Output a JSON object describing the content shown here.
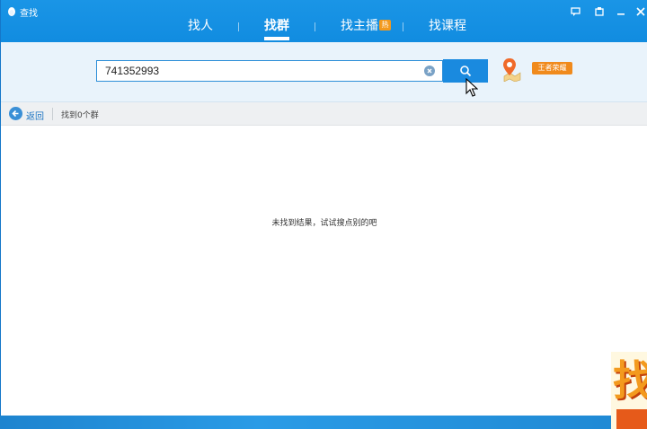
{
  "window": {
    "title": "查找",
    "tabs": [
      {
        "label": "找人",
        "active": false
      },
      {
        "label": "找群",
        "active": true
      },
      {
        "label": "找主播",
        "active": false,
        "badge": "热"
      },
      {
        "label": "找课程",
        "active": false
      }
    ]
  },
  "search": {
    "value": "741352993"
  },
  "game_tag": "王者荣耀",
  "info_bar": {
    "back_label": "返回",
    "result_count": "找到0个群"
  },
  "results": {
    "empty_message": "未找到结果，试试搜点别的吧"
  },
  "promo": {
    "text": "找"
  },
  "colors": {
    "titlebar": "#1a95e6",
    "accent": "#1a8adf",
    "badge": "#f39a1e",
    "band": "#e9f3fb"
  }
}
